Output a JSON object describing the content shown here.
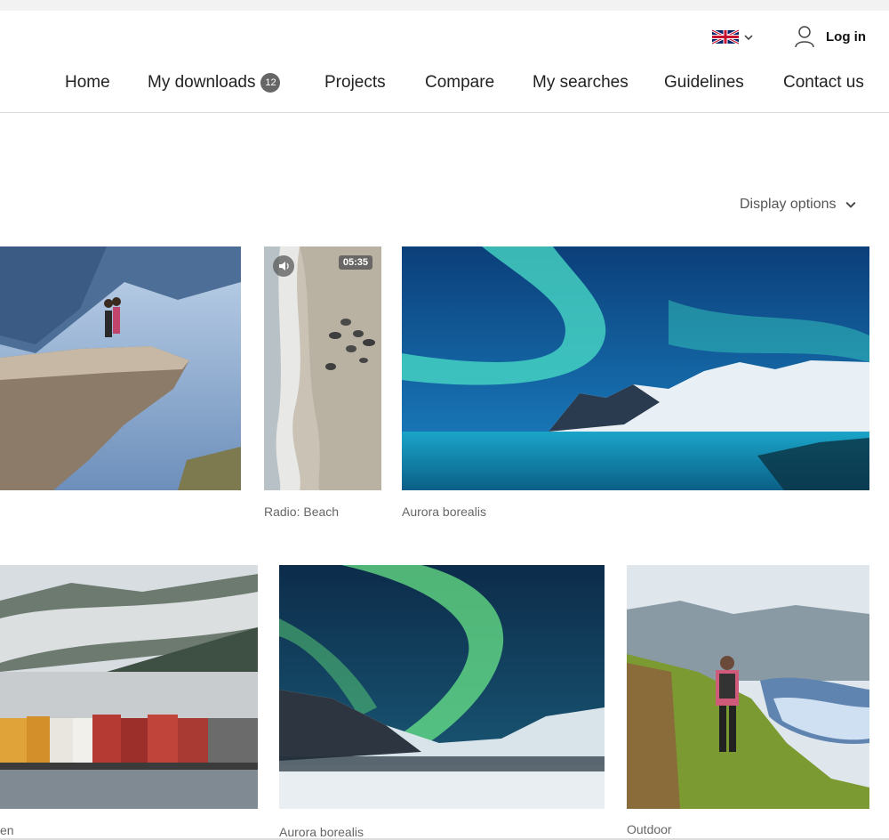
{
  "header": {
    "language": "English (UK)",
    "login_label": "Log in"
  },
  "nav": {
    "items": [
      {
        "label": "Home"
      },
      {
        "label": "My downloads",
        "badge": "12"
      },
      {
        "label": "Projects"
      },
      {
        "label": "Compare"
      },
      {
        "label": "My searches"
      },
      {
        "label": "Guidelines"
      },
      {
        "label": "Contact us"
      }
    ]
  },
  "toolbar": {
    "display_options_label": "Display options"
  },
  "gallery": {
    "row1": [
      {
        "caption": "",
        "image": "couple-on-cliff-fjord"
      },
      {
        "caption": "Radio: Beach",
        "image": "aerial-beach-seals",
        "duration": "05:35",
        "has_audio": true
      },
      {
        "caption": "Aurora borealis",
        "image": "aurora-over-mountains-sea"
      }
    ],
    "row2": [
      {
        "caption": "en",
        "image": "colorful-waterfront-town"
      },
      {
        "caption": "Aurora borealis",
        "image": "aurora-over-snowy-valley"
      },
      {
        "caption": "Outdoor",
        "image": "hiker-above-fjord"
      }
    ]
  }
}
